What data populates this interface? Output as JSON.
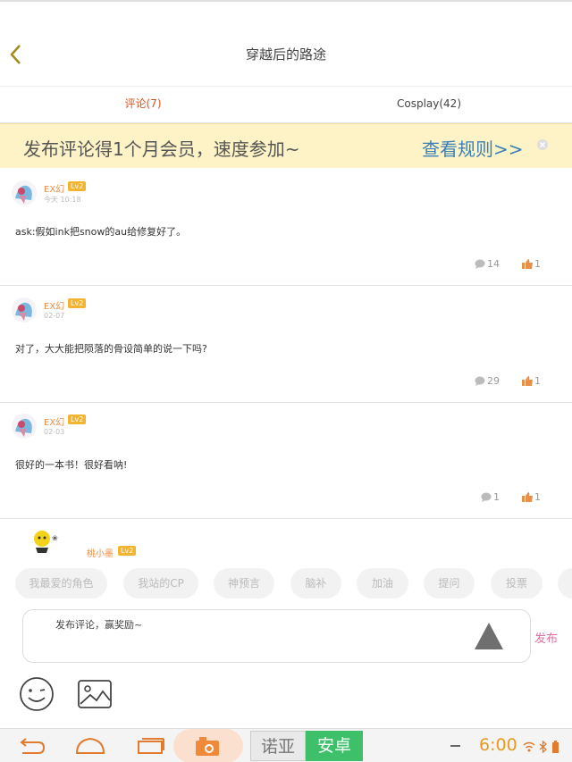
{
  "header": {
    "title": "穿越后的路途"
  },
  "tabs": [
    {
      "label": "评论(7)",
      "active": true
    },
    {
      "label": "Cosplay(42)",
      "active": false
    }
  ],
  "banner": {
    "text": "发布评论得1个月会员，速度参加~",
    "link": "查看规则>>"
  },
  "comments": [
    {
      "user": "EX幻",
      "level": "Lv2",
      "date": "今天 10:18",
      "text": "ask:假如ink把snow的au给修复好了。",
      "replies": "14",
      "likes": "1"
    },
    {
      "user": "EX幻",
      "level": "Lv2",
      "date": "02-07",
      "text": "对了，大大能把陨落的骨设简单的说一下吗?",
      "replies": "29",
      "likes": "1"
    },
    {
      "user": "EX幻",
      "level": "Lv2",
      "date": "02-03",
      "text": "很好的一本书！很好看呐!",
      "replies": "1",
      "likes": "1"
    }
  ],
  "partial_comment": {
    "user": "桃小墨",
    "level": "Lv2"
  },
  "tag_chips": [
    "我最爱的角色",
    "我站的CP",
    "神预言",
    "脑补",
    "加油",
    "提问",
    "投票"
  ],
  "composer": {
    "placeholder": "发布评论，赢奖励~",
    "publish": "发布"
  },
  "navbar": {
    "brand_left": "诺亚",
    "brand_right": "安卓",
    "time": "6:00"
  },
  "colors": {
    "accent": "#d9531e",
    "username": "#e8904a",
    "level_badge": "#f2b431",
    "banner_bg": "#fdf3c7",
    "link": "#3a7fb5",
    "publish": "#e06fa0",
    "brand_green": "#3ec06a",
    "clock": "#e79a1d"
  },
  "icons": [
    "back-chevron-icon",
    "close-circle-icon",
    "comment-bubble-icon",
    "thumbs-up-icon",
    "send-triangle-icon",
    "emoji-icon",
    "image-icon",
    "nav-back-icon",
    "nav-home-icon",
    "nav-recents-icon",
    "camera-icon",
    "wifi-icon",
    "bluetooth-icon",
    "battery-icon"
  ]
}
